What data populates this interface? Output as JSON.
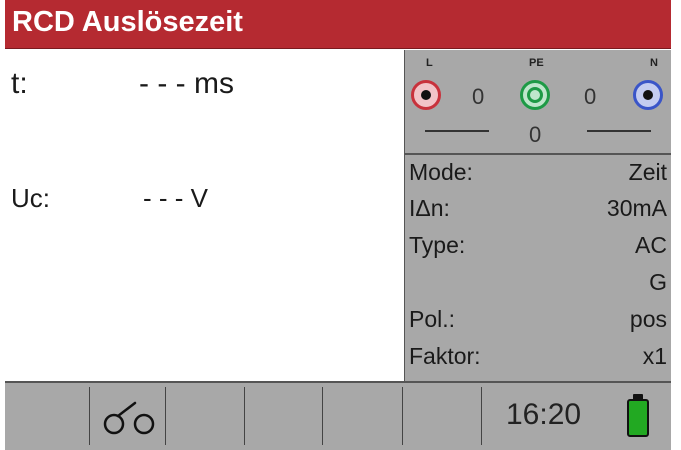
{
  "header": {
    "title": "RCD Auslösezeit"
  },
  "measurement": {
    "t_label": "t:",
    "t_value": "- - - ms",
    "uc_label": "Uc:",
    "uc_value": "- - - V"
  },
  "probes": {
    "L": {
      "label": "L",
      "color": "#c8323c"
    },
    "PE": {
      "label": "PE",
      "color": "#1e9a46"
    },
    "N": {
      "label": "N",
      "color": "#3a55c8"
    },
    "L_PE_value": "0",
    "PE_N_value": "0",
    "L_N_value": "0"
  },
  "params": [
    {
      "key": "Mode:",
      "value": "Zeit"
    },
    {
      "key": "IΔn:",
      "value": "30mA"
    },
    {
      "key": "Type:",
      "value": "AC"
    },
    {
      "key": "",
      "value": "G"
    },
    {
      "key": "Pol.:",
      "value": "pos"
    },
    {
      "key": "Faktor:",
      "value": "x1"
    }
  ],
  "footer": {
    "icon": "probe-leads-icon",
    "time": "16:20",
    "battery_color": "#22a922"
  }
}
